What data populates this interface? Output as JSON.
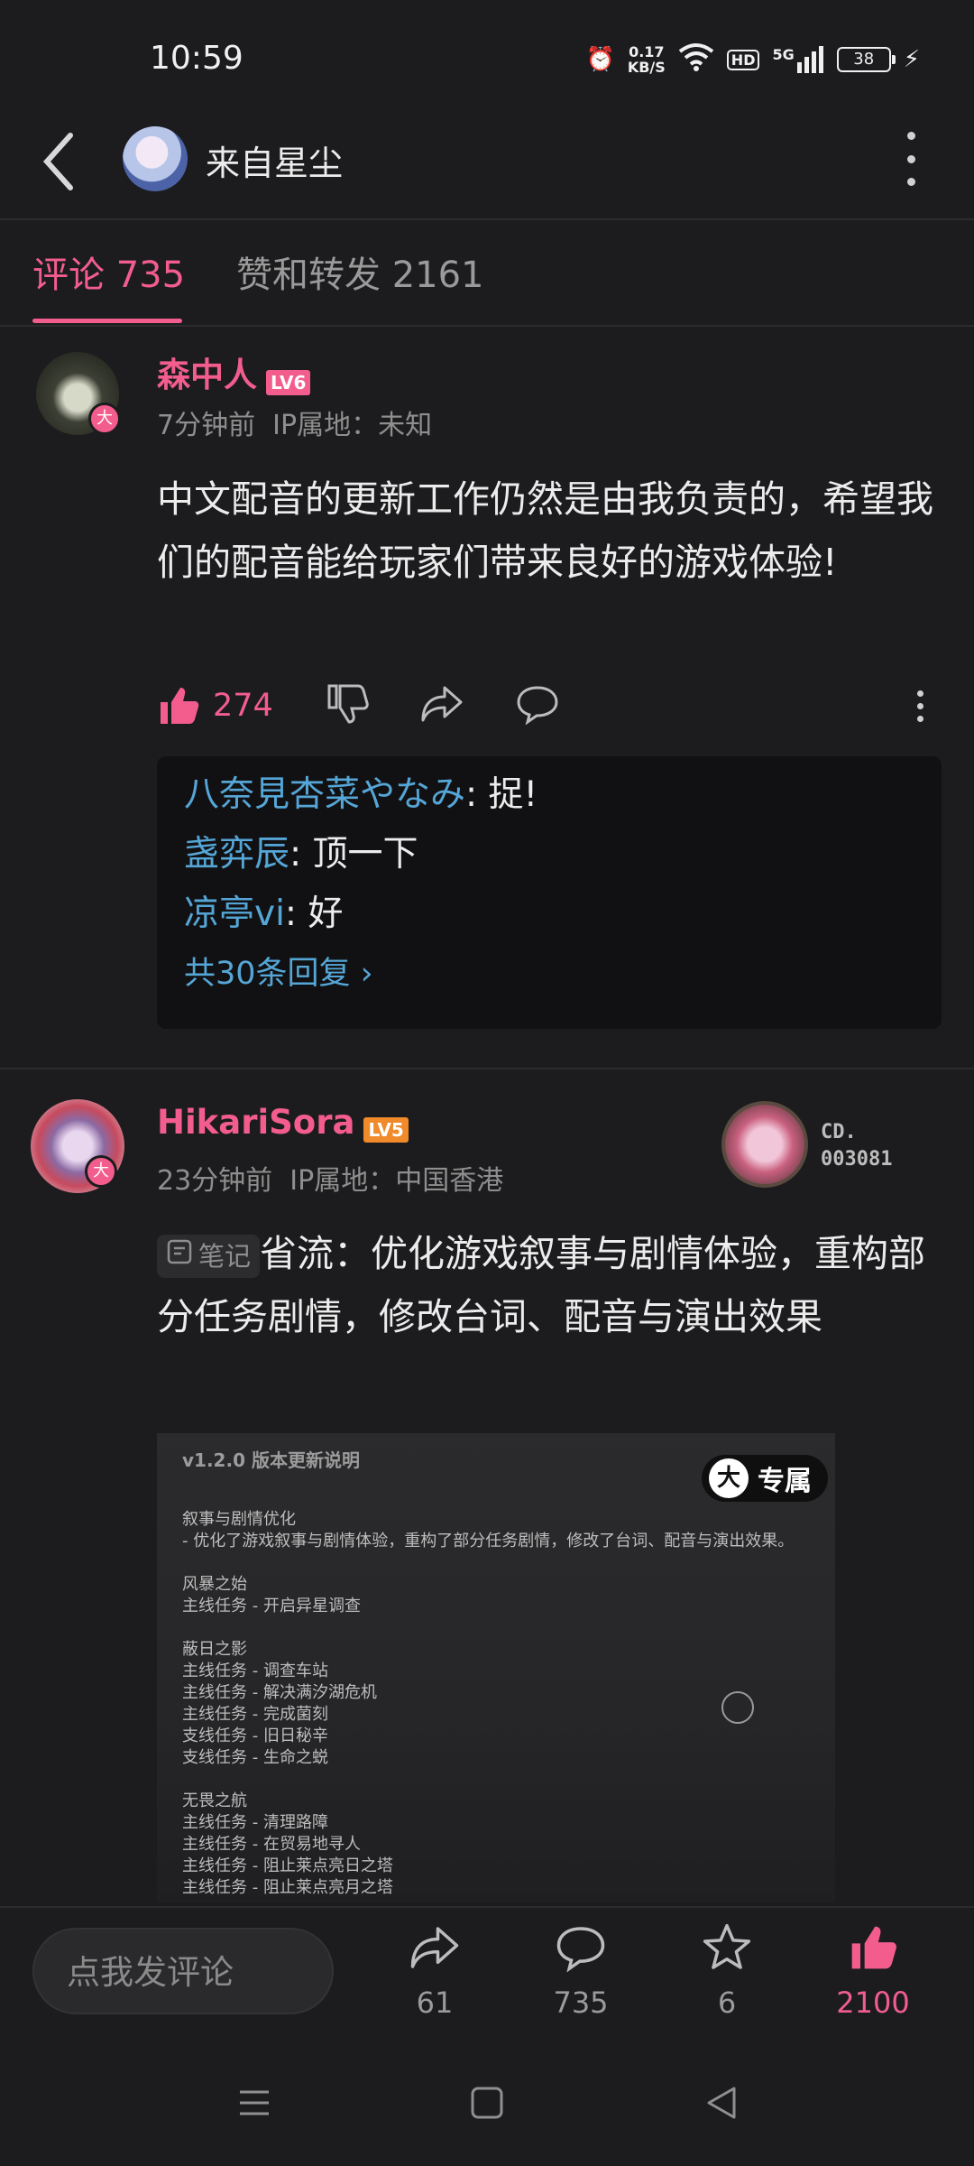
{
  "status_bar": {
    "time": "10:59",
    "net_speed": "0.17",
    "net_unit": "KB/S",
    "hd": "HD",
    "signal": "5G",
    "battery": "38"
  },
  "header": {
    "title": "来自星尘"
  },
  "tabs": [
    {
      "label": "评论 735"
    },
    {
      "label": "赞和转发 2161"
    }
  ],
  "comments": [
    {
      "user": "森中人",
      "level": "LV6",
      "level_color": "#f25d8e",
      "time": "7分钟前",
      "ip": "IP属地：未知",
      "text": "中文配音的更新工作仍然是由我负责的，希望我们的配音能给玩家们带来良好的游戏体验!",
      "likes": "274",
      "replies": [
        {
          "user": "八奈見杏菜やなみ",
          "text": ": 捉!"
        },
        {
          "user": "盏弈辰",
          "text": ": 顶一下"
        },
        {
          "user": "凉亭vi",
          "text": ": 好"
        }
      ],
      "reply_more": "共30条回复 ›"
    },
    {
      "user": "HikariSora",
      "level": "LV5",
      "level_color": "#f08a2a",
      "time": "23分钟前",
      "ip": "IP属地：中国香港",
      "fan_label": "CD.",
      "fan_no": "003081",
      "note_tag": "笔记",
      "text": "省流：优化游戏叙事与剧情体验，重构部分任务剧情，修改台词、配音与演出效果",
      "exclusive": "专属",
      "exclusive_icon": "大",
      "image": {
        "heading": "v1.2.0 版本更新说明",
        "lines": [
          "叙事与剧情优化",
          "- 优化了游戏叙事与剧情体验，重构了部分任务剧情，修改了台词、配音与演出效果。",
          "",
          "风暴之始",
          "主线任务 - 开启异星调查",
          "",
          "蔽日之影",
          "主线任务 - 调查车站",
          "主线任务 - 解决满汐湖危机",
          "主线任务 - 完成菌刻",
          "支线任务 - 旧日秘辛",
          "支线任务 - 生命之蜕",
          "",
          "无畏之航",
          "主线任务 - 清理路障",
          "主线任务 - 在贸易地寻人",
          "主线任务 - 阻止莱点亮日之塔",
          "主线任务 - 阻止莱点亮月之塔"
        ]
      }
    }
  ],
  "bottom_bar": {
    "input_placeholder": "点我发评论",
    "share": "61",
    "comment": "735",
    "fav": "6",
    "like": "2100"
  },
  "colors": {
    "accent": "#f25d8e",
    "link": "#55a6d6",
    "background": "#1c1c1e"
  }
}
